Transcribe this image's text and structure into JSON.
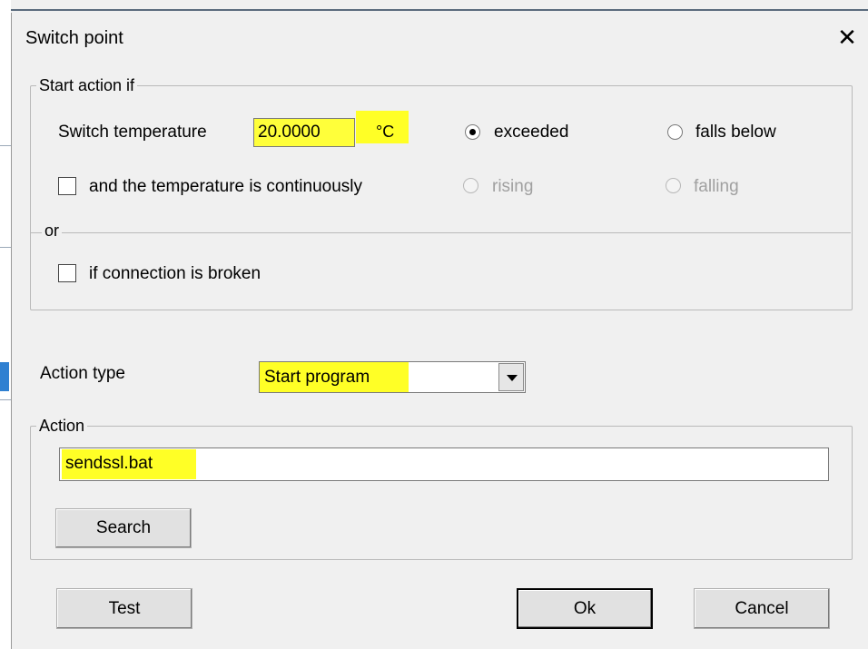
{
  "dialog": {
    "title": "Switch point",
    "close_glyph": "✕"
  },
  "start_group": {
    "legend": "Start action if",
    "switch_temp_label": "Switch temperature",
    "switch_temp_value": "20.0000",
    "unit": "°C",
    "radio_exceeded": "exceeded",
    "radio_falls_below": "falls below",
    "exceeded_selected": true,
    "continuous_label": "and the temperature is continuously",
    "continuous_checked": false,
    "radio_rising": "rising",
    "radio_falling": "falling",
    "or_label": "or",
    "broken_label": "if connection is broken",
    "broken_checked": false
  },
  "action_type": {
    "label": "Action type",
    "selected": "Start program"
  },
  "action_group": {
    "legend": "Action",
    "value": "sendssl.bat",
    "search_label": "Search"
  },
  "buttons": {
    "test": "Test",
    "ok": "Ok",
    "cancel": "Cancel"
  },
  "colors": {
    "highlight": "#ffff26",
    "disabled_text": "#a0a0a0"
  }
}
